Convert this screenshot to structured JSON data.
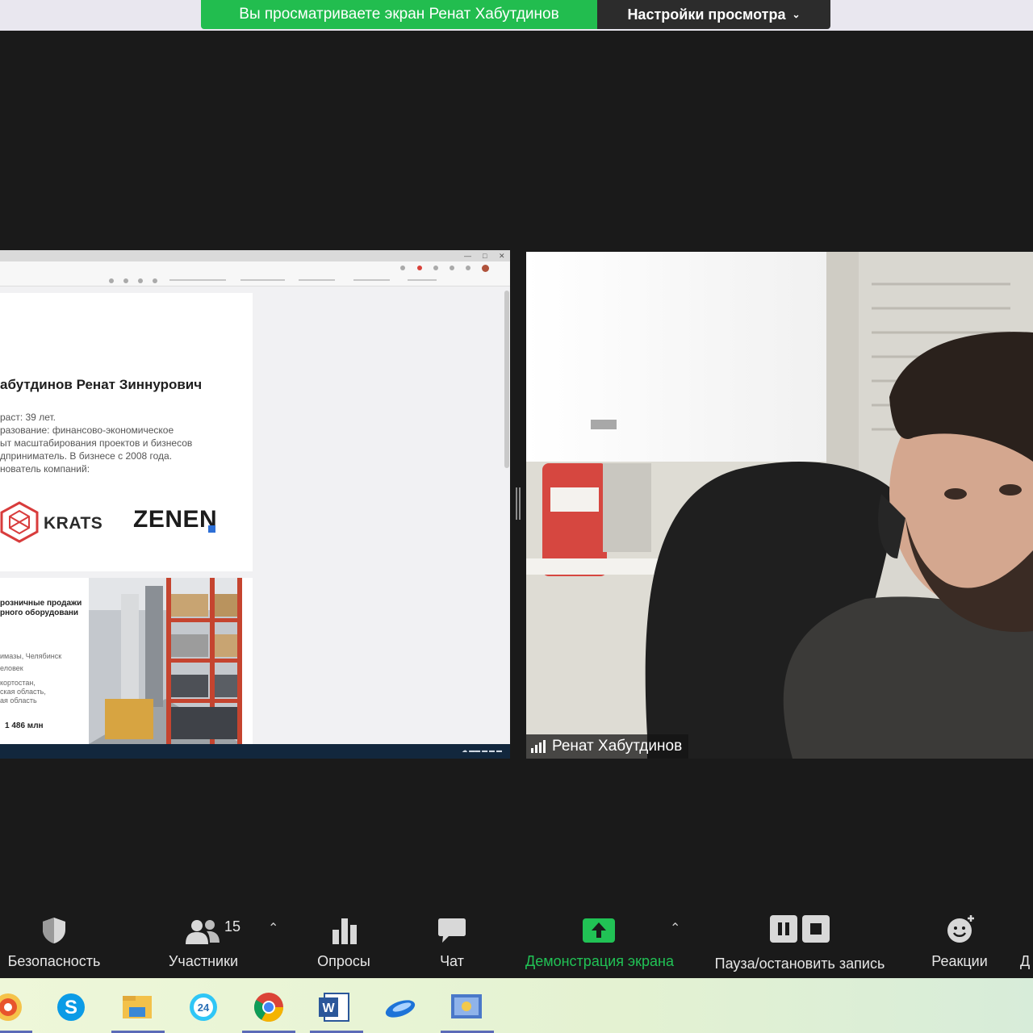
{
  "banner": {
    "sharing_text": "Вы просматриваете экран Ренат Хабутдинов",
    "view_settings_label": "Настройки просмотра"
  },
  "shared_screen": {
    "slide_name": "абутдинов Ренат Зиннурович",
    "lines": [
      "раст: 39 лет.",
      "разование: финансово-экономическое",
      "ыт масштабирования проектов и бизнесов",
      "дприниматель. В бизнесе с 2008 года.",
      "нователь компаний:"
    ],
    "krats": "KRATS",
    "zenen": "ZENEN",
    "slide2_title": [
      "розничные продажи",
      "рного оборудовани"
    ],
    "slide2_lines": [
      "имазы, Челябинск",
      "еловек",
      "кортостан,",
      "ская область,",
      "ая область"
    ],
    "slide2_value": "1 486 млн"
  },
  "participant": {
    "name": "Ренат Хабутдинов"
  },
  "toolbar": {
    "security_label": "Безопасность",
    "participants_label": "Участники",
    "participants_count": "15",
    "polls_label": "Опросы",
    "chat_label": "Чат",
    "share_label": "Демонстрация экрана",
    "record_label": "Пауза/остановить запись",
    "reactions_label": "Реакции",
    "cut_label": "Д"
  },
  "colors": {
    "banner_green": "#22bd4f",
    "share_green": "#21c255",
    "toolbar_bg": "#1a1a1a"
  },
  "taskbar_apps": [
    "yandex-browser",
    "skype",
    "file-explorer",
    "bitrix24",
    "chrome",
    "word",
    "mail-app",
    "zoom-app"
  ]
}
